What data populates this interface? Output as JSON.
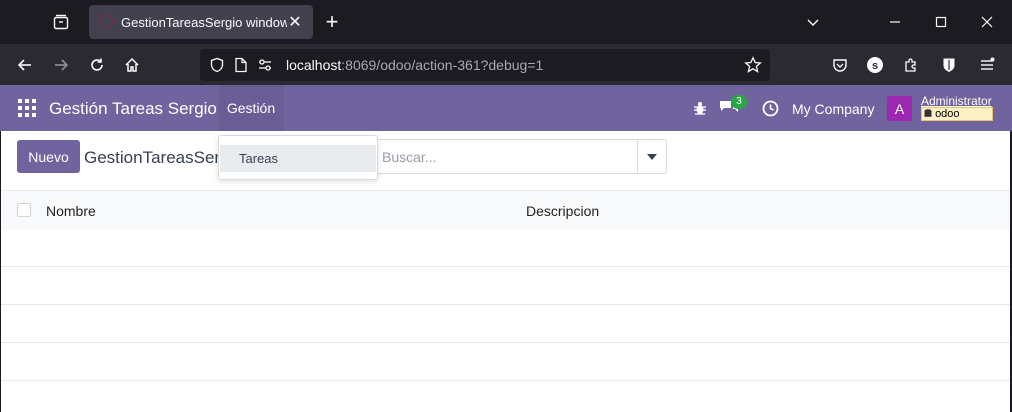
{
  "browser": {
    "tab_title": "GestionTareasSergio window",
    "url_host": "localhost",
    "url_path": ":8069/odoo/action-361?debug=1"
  },
  "odoo": {
    "app_name": "Gestión Tareas Sergio",
    "menu_gestion": "Gestión",
    "chat_count": "3",
    "company": "My Company",
    "avatar_letter": "A",
    "user": "Administrator",
    "db_name": "odoo"
  },
  "control": {
    "new_button": "Nuevo",
    "breadcrumb": "GestionTareasSergio",
    "search_placeholder": "Buscar..."
  },
  "table": {
    "columns": [
      "Nombre",
      "Descripcion"
    ]
  },
  "dropdown": {
    "items": [
      "Tareas"
    ]
  },
  "colors": {
    "brand": "#71639e",
    "chat_badge": "#28a745",
    "avatar": "#9c27b0"
  }
}
